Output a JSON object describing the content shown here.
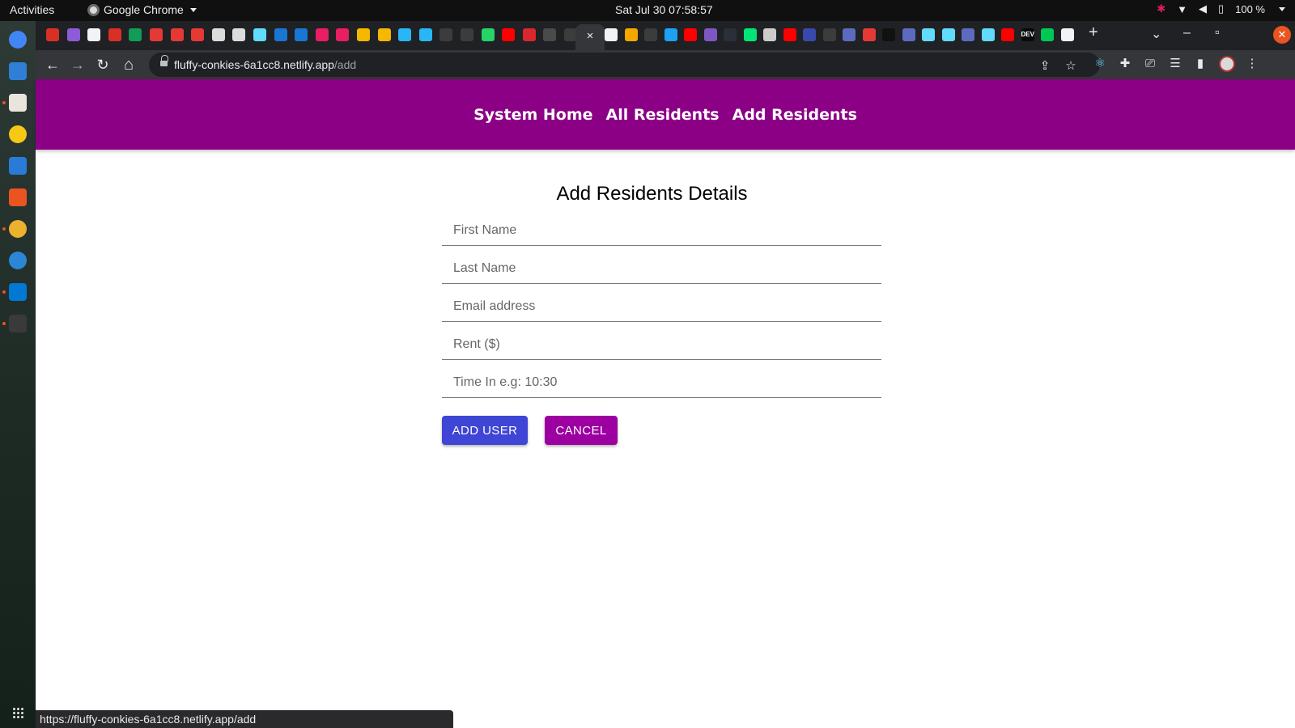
{
  "system_bar": {
    "activities": "Activities",
    "app_name": "Google Chrome",
    "clock": "Sat Jul 30  07:58:57",
    "battery": "100 %"
  },
  "browser": {
    "url_domain": "fluffy-conkies-6a1cc8.netlify.app",
    "url_path": "/add",
    "status_url": "https://fluffy-conkies-6a1cc8.netlify.app/add",
    "active_tab_close": "×",
    "new_tab": "+",
    "tab_search": "⌄",
    "minimize": "–",
    "restore": "▫",
    "close": "✕",
    "nav": {
      "back": "←",
      "forward": "→",
      "reload": "↻",
      "home": "⌂"
    },
    "toolbar_icons": {
      "share": "⇪",
      "bookmark": "☆",
      "extensions": "✚",
      "cast": "⎚",
      "reading_list": "☰",
      "side_panel": "▮",
      "menu": "⋮"
    },
    "tab_favicons": [
      {
        "icon": "gmail-icon",
        "color": "#d93025"
      },
      {
        "icon": "hacker-icon",
        "color": "#8e5bd8"
      },
      {
        "icon": "globe-icon",
        "color": "#f1f3f4"
      },
      {
        "icon": "gmail-icon",
        "color": "#d93025"
      },
      {
        "icon": "sheets-icon",
        "color": "#0f9d58"
      },
      {
        "icon": "circle-icon",
        "color": "#e53935"
      },
      {
        "icon": "circle-icon",
        "color": "#e53935"
      },
      {
        "icon": "circle-icon",
        "color": "#e53935"
      },
      {
        "icon": "circle-icon",
        "color": "#dcdcdc"
      },
      {
        "icon": "circle-icon",
        "color": "#dcdcdc"
      },
      {
        "icon": "react-icon",
        "color": "#61dafb"
      },
      {
        "icon": "play-icon",
        "color": "#1976d2"
      },
      {
        "icon": "play-icon",
        "color": "#1976d2"
      },
      {
        "icon": "media-icon",
        "color": "#e91e63"
      },
      {
        "icon": "media-icon",
        "color": "#e91e63"
      },
      {
        "icon": "bolt-icon",
        "color": "#f5b700"
      },
      {
        "icon": "crown-icon",
        "color": "#f5b700"
      },
      {
        "icon": "udemy-icon",
        "color": "#29b6f6"
      },
      {
        "icon": "udemy-icon",
        "color": "#29b6f6"
      },
      {
        "icon": "github-icon",
        "color": "#3c3c3c"
      },
      {
        "icon": "github-icon",
        "color": "#3c3c3c"
      },
      {
        "icon": "whatsapp-icon",
        "color": "#25d366"
      },
      {
        "icon": "youtube-icon",
        "color": "#ff0000"
      },
      {
        "icon": "mega-icon",
        "color": "#d9272e"
      },
      {
        "icon": "nft-icon",
        "color": "#4a4a4a"
      },
      {
        "icon": "github-icon",
        "color": "#3c3c3c"
      }
    ],
    "tab_favicons_right": [
      {
        "icon": "globe-icon",
        "color": "#f1f3f4"
      },
      {
        "icon": "diamond-icon",
        "color": "#f5a700"
      },
      {
        "icon": "github-icon",
        "color": "#3c3c3c"
      },
      {
        "icon": "twitter-icon",
        "color": "#1da1f2"
      },
      {
        "icon": "youtube-icon",
        "color": "#ff0000"
      },
      {
        "icon": "crown-icon",
        "color": "#7e57c2"
      },
      {
        "icon": "docs-icon",
        "color": "#2a2f3a"
      },
      {
        "icon": "k-icon",
        "color": "#00e676"
      },
      {
        "icon": "chrome-icon",
        "color": "#cccccc"
      },
      {
        "icon": "youtube-icon",
        "color": "#ff0000"
      },
      {
        "icon": "p-icon",
        "color": "#3949ab"
      },
      {
        "icon": "github-icon",
        "color": "#3c3c3c"
      },
      {
        "icon": "m-icon",
        "color": "#5c6bc0"
      },
      {
        "icon": "n-icon",
        "color": "#e53935"
      },
      {
        "icon": "terminal-icon",
        "color": "#111111"
      },
      {
        "icon": "m-icon",
        "color": "#5c6bc0"
      },
      {
        "icon": "react-icon",
        "color": "#61dafb"
      },
      {
        "icon": "react-icon",
        "color": "#61dafb"
      },
      {
        "icon": "m-icon",
        "color": "#5c6bc0"
      },
      {
        "icon": "react-icon",
        "color": "#61dafb"
      },
      {
        "icon": "youtube-icon",
        "color": "#ff0000"
      },
      {
        "icon": "dev-icon",
        "color": "#0a0a0a",
        "label": "DEV"
      },
      {
        "icon": "diamond-icon",
        "color": "#00c853"
      },
      {
        "icon": "globe-icon",
        "color": "#f1f3f4"
      }
    ]
  },
  "dock": [
    {
      "icon": "chrome-icon",
      "color": "#4285f4",
      "running": false
    },
    {
      "icon": "thunderbird-icon",
      "color": "#2f7fd6",
      "running": false
    },
    {
      "icon": "files-icon",
      "color": "#e9e4dc",
      "running": true
    },
    {
      "icon": "rhythmbox-icon",
      "color": "#f6c915",
      "running": false
    },
    {
      "icon": "writer-icon",
      "color": "#2a7bd8",
      "running": false
    },
    {
      "icon": "software-icon",
      "color": "#e95420",
      "running": false
    },
    {
      "icon": "slack-icon",
      "color": "#ecb22e",
      "running": true
    },
    {
      "icon": "help-icon",
      "color": "#2c86d6",
      "running": false
    },
    {
      "icon": "vscode-icon",
      "color": "#0078d4",
      "running": true
    },
    {
      "icon": "terminal-icon",
      "color": "#3a3a3a",
      "running": true
    }
  ],
  "app_nav": {
    "home": "System Home",
    "all_residents": "All Residents",
    "add_residents": "Add Residents"
  },
  "form": {
    "title": "Add Residents Details",
    "fields": {
      "first_name": {
        "placeholder": "First Name",
        "value": ""
      },
      "last_name": {
        "placeholder": "Last Name",
        "value": ""
      },
      "email": {
        "placeholder": "Email address",
        "value": ""
      },
      "rent": {
        "placeholder": "Rent ($)",
        "value": ""
      },
      "time_in": {
        "placeholder": "Time In e.g: 10:30",
        "value": ""
      }
    },
    "add_button": "ADD USER",
    "cancel_button": "CANCEL"
  },
  "colors": {
    "nav_bg": "#8b0084",
    "add_button": "#3f45d5",
    "cancel_button": "#9c00a1"
  }
}
